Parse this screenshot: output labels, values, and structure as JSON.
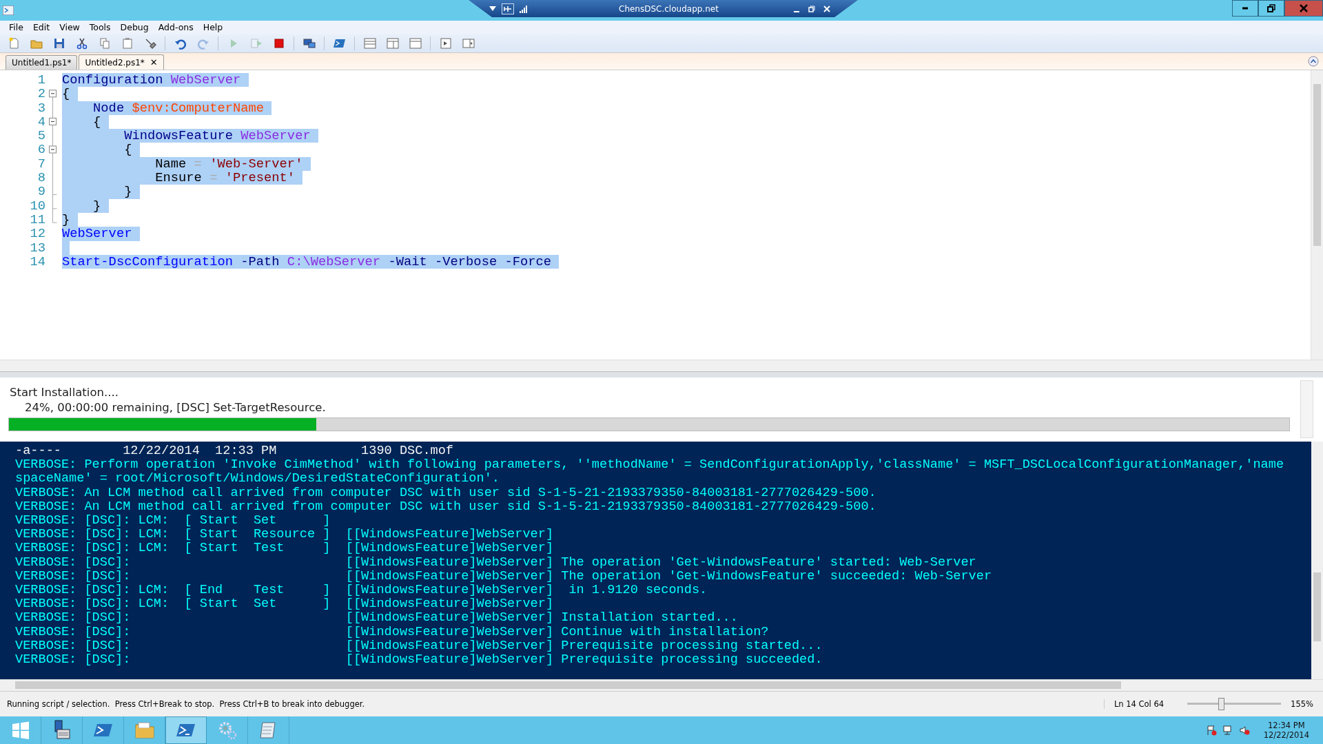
{
  "connection_bar": {
    "title": "ChensDSC.cloudapp.net"
  },
  "menu": [
    "File",
    "Edit",
    "View",
    "Tools",
    "Debug",
    "Add-ons",
    "Help"
  ],
  "toolbar": [
    {
      "kind": "new",
      "disabled": false
    },
    {
      "kind": "open",
      "disabled": false
    },
    {
      "kind": "save",
      "disabled": false
    },
    {
      "kind": "cut",
      "disabled": false
    },
    {
      "kind": "copy",
      "disabled": false
    },
    {
      "kind": "paste",
      "disabled": false
    },
    {
      "kind": "clear",
      "disabled": false
    },
    {
      "kind": "undo",
      "disabled": false
    },
    {
      "kind": "redo",
      "disabled": true
    },
    {
      "kind": "run",
      "disabled": true
    },
    {
      "kind": "run-selection",
      "disabled": true
    },
    {
      "kind": "stop",
      "disabled": false
    },
    {
      "kind": "remote",
      "disabled": false
    },
    {
      "kind": "console",
      "disabled": false
    },
    {
      "kind": "layout-top",
      "disabled": false
    },
    {
      "kind": "layout-right",
      "disabled": false
    },
    {
      "kind": "layout-max",
      "disabled": false
    },
    {
      "kind": "commands",
      "disabled": false
    },
    {
      "kind": "addon",
      "disabled": false
    }
  ],
  "tabs": [
    {
      "label": "Untitled1.ps1*",
      "selected": false
    },
    {
      "label": "Untitled2.ps1*",
      "selected": true,
      "close": "✕"
    }
  ],
  "editor": {
    "selection": true,
    "lines": [
      {
        "number": "1",
        "tokens": [
          {
            "kind": "keyword",
            "text": "Configuration "
          },
          {
            "kind": "name",
            "text": "WebServer"
          }
        ]
      },
      {
        "number": "2",
        "expanded": true,
        "tokens": [
          {
            "kind": "plain",
            "text": "{"
          }
        ],
        "children": [
          {
            "number": "3",
            "tokens": [
              {
                "kind": "keyword",
                "text": "    Node "
              },
              {
                "kind": "variable",
                "text": "$env:ComputerName"
              }
            ]
          },
          {
            "number": "4",
            "expanded": true,
            "tokens": [
              {
                "kind": "plain",
                "text": "    {"
              }
            ],
            "children": [
              {
                "number": "5",
                "tokens": [
                  {
                    "kind": "keyword",
                    "text": "        WindowsFeature "
                  },
                  {
                    "kind": "name",
                    "text": "WebServer"
                  }
                ]
              },
              {
                "number": "6",
                "expanded": true,
                "tokens": [
                  {
                    "kind": "plain",
                    "text": "        {"
                  }
                ],
                "children": [
                  {
                    "number": "7",
                    "tokens": [
                      {
                        "kind": "plain",
                        "text": "            Name "
                      },
                      {
                        "kind": "operator",
                        "text": "="
                      },
                      {
                        "kind": "string",
                        "text": " 'Web-Server'"
                      }
                    ]
                  },
                  {
                    "number": "8",
                    "tokens": [
                      {
                        "kind": "plain",
                        "text": "            Ensure "
                      },
                      {
                        "kind": "operator",
                        "text": "="
                      },
                      {
                        "kind": "string",
                        "text": " 'Present'"
                      }
                    ]
                  },
                  {
                    "number": "9",
                    "tokens": [
                      {
                        "kind": "plain",
                        "text": "        }"
                      }
                    ]
                  }
                ]
              },
              {
                "number": "10",
                "tokens": [
                  {
                    "kind": "plain",
                    "text": "    }"
                  }
                ]
              }
            ]
          },
          {
            "number": "11",
            "tokens": [
              {
                "kind": "plain",
                "text": "}"
              }
            ]
          }
        ]
      },
      {
        "number": "12",
        "tokens": [
          {
            "kind": "command",
            "text": "WebServer"
          }
        ]
      },
      {
        "number": "13"
      },
      {
        "number": "14",
        "tokens": [
          {
            "kind": "command",
            "text": "Start-DscConfiguration "
          },
          {
            "kind": "param",
            "text": "-Path "
          },
          {
            "kind": "name",
            "text": "C:\\WebServer"
          },
          {
            "kind": "param",
            "text": " -Wait -Verbose -Force"
          }
        ]
      }
    ]
  },
  "progress": {
    "title": "Start Installation....",
    "status": "24%, 00:00:00 remaining, [DSC] Set-TargetResource.",
    "level": 0.24
  },
  "console": {
    "lines": [
      {
        "kind": "output",
        "text": "-a----        12/22/2014  12:33 PM           1390 DSC.mof"
      },
      {
        "kind": "verbose",
        "text": "VERBOSE: Perform operation 'Invoke CimMethod' with following parameters, ''methodName' = SendConfigurationApply,'className' = MSFT_DSCLocalConfigurationManager,'name"
      },
      {
        "kind": "verbose",
        "text": "spaceName' = root/Microsoft/Windows/DesiredStateConfiguration'."
      },
      {
        "kind": "verbose",
        "text": "VERBOSE: An LCM method call arrived from computer DSC with user sid S-1-5-21-2193379350-84003181-2777026429-500."
      },
      {
        "kind": "verbose",
        "text": "VERBOSE: An LCM method call arrived from computer DSC with user sid S-1-5-21-2193379350-84003181-2777026429-500."
      },
      {
        "kind": "verbose",
        "text": "VERBOSE: [DSC]: LCM:  [ Start  Set      ]"
      },
      {
        "kind": "verbose",
        "text": "VERBOSE: [DSC]: LCM:  [ Start  Resource ]  [[WindowsFeature]WebServer]"
      },
      {
        "kind": "verbose",
        "text": "VERBOSE: [DSC]: LCM:  [ Start  Test     ]  [[WindowsFeature]WebServer]"
      },
      {
        "kind": "verbose",
        "text": "VERBOSE: [DSC]:                            [[WindowsFeature]WebServer] The operation 'Get-WindowsFeature' started: Web-Server"
      },
      {
        "kind": "verbose",
        "text": "VERBOSE: [DSC]:                            [[WindowsFeature]WebServer] The operation 'Get-WindowsFeature' succeeded: Web-Server"
      },
      {
        "kind": "verbose",
        "text": "VERBOSE: [DSC]: LCM:  [ End    Test     ]  [[WindowsFeature]WebServer]  in 1.9120 seconds."
      },
      {
        "kind": "verbose",
        "text": "VERBOSE: [DSC]: LCM:  [ Start  Set      ]  [[WindowsFeature]WebServer]"
      },
      {
        "kind": "verbose",
        "text": "VERBOSE: [DSC]:                            [[WindowsFeature]WebServer] Installation started..."
      },
      {
        "kind": "verbose",
        "text": "VERBOSE: [DSC]:                            [[WindowsFeature]WebServer] Continue with installation?"
      },
      {
        "kind": "verbose",
        "text": "VERBOSE: [DSC]:                            [[WindowsFeature]WebServer] Prerequisite processing started..."
      },
      {
        "kind": "verbose",
        "text": "VERBOSE: [DSC]:                            [[WindowsFeature]WebServer] Prerequisite processing succeeded."
      }
    ]
  },
  "status_bar": {
    "message": "Running script / selection.  Press Ctrl+Break to stop.  Press Ctrl+B to break into debugger.",
    "position": "Ln 14  Col 64",
    "zoom": {
      "level": 0.36,
      "reading": "155%"
    }
  },
  "taskbar": {
    "items": [
      {
        "kind": "start",
        "selected": false
      },
      {
        "kind": "server",
        "selected": false
      },
      {
        "kind": "shell",
        "selected": false
      },
      {
        "kind": "folder",
        "selected": false
      },
      {
        "kind": "ise",
        "selected": true
      },
      {
        "kind": "gear",
        "selected": false
      },
      {
        "kind": "notepad",
        "selected": false
      }
    ],
    "clock": {
      "time": "12:34 PM",
      "date": "12/22/2014"
    }
  }
}
